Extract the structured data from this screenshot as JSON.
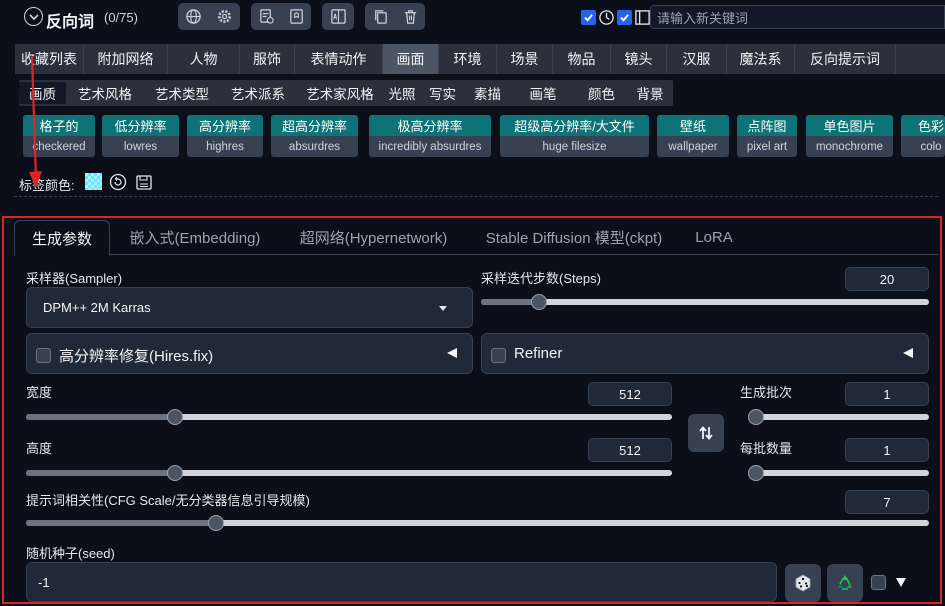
{
  "prompt_toolbar": {
    "title": "反向词",
    "count": "(0/75)",
    "new_keyword_placeholder": "请输入新关键词"
  },
  "categories": [
    "收藏列表",
    "附加网络",
    "人物",
    "服饰",
    "表情动作",
    "画面",
    "环境",
    "场景",
    "物品",
    "镜头",
    "汉服",
    "魔法系",
    "反向提示词"
  ],
  "active_category": "画面",
  "subcategories": [
    "画质",
    "艺术风格",
    "艺术类型",
    "艺术派系",
    "艺术家风格",
    "光照",
    "写实",
    "素描",
    "画笔",
    "颜色",
    "背景"
  ],
  "active_subcategory": "画质",
  "tags": [
    {
      "zh": "格子的",
      "en": "checkered"
    },
    {
      "zh": "低分辨率",
      "en": "lowres"
    },
    {
      "zh": "高分辨率",
      "en": "highres"
    },
    {
      "zh": "超高分辨率",
      "en": "absurdres"
    },
    {
      "zh": "极高分辨率",
      "en": "incredibly absurdres"
    },
    {
      "zh": "超级高分辨率/大文件",
      "en": "huge filesize"
    },
    {
      "zh": "壁纸",
      "en": "wallpaper"
    },
    {
      "zh": "点阵图",
      "en": "pixel art"
    },
    {
      "zh": "单色图片",
      "en": "monochrome"
    },
    {
      "zh": "色彩",
      "en": "colo"
    }
  ],
  "tag_color_label": "标签颜色:",
  "gen_tabs": [
    "生成参数",
    "嵌入式(Embedding)",
    "超网络(Hypernetwork)",
    "Stable Diffusion 模型(ckpt)",
    "LoRA"
  ],
  "active_gen_tab": "生成参数",
  "sampler": {
    "label": "采样器(Sampler)",
    "value": "DPM++ 2M Karras"
  },
  "steps": {
    "label": "采样迭代步数(Steps)",
    "value": "20",
    "level": 0.13
  },
  "hires": {
    "label": "高分辨率修复(Hires.fix)"
  },
  "refiner": {
    "label": "Refiner"
  },
  "width": {
    "label": "宽度",
    "value": "512",
    "level": 0.23
  },
  "height": {
    "label": "高度",
    "value": "512",
    "level": 0.23
  },
  "batch_count": {
    "label": "生成批次",
    "value": "1",
    "level": 0.0
  },
  "batch_size": {
    "label": "每批数量",
    "value": "1",
    "level": 0.0
  },
  "cfg": {
    "label": "提示词相关性(CFG Scale/无分类器信息引导规模)",
    "value": "7",
    "level": 0.21
  },
  "seed": {
    "label": "随机种子(seed)",
    "value": "-1"
  },
  "colors": {
    "accent_tag": "#0d7377",
    "highlight_red": "#dc2626",
    "checkbox_blue": "#2563eb"
  }
}
